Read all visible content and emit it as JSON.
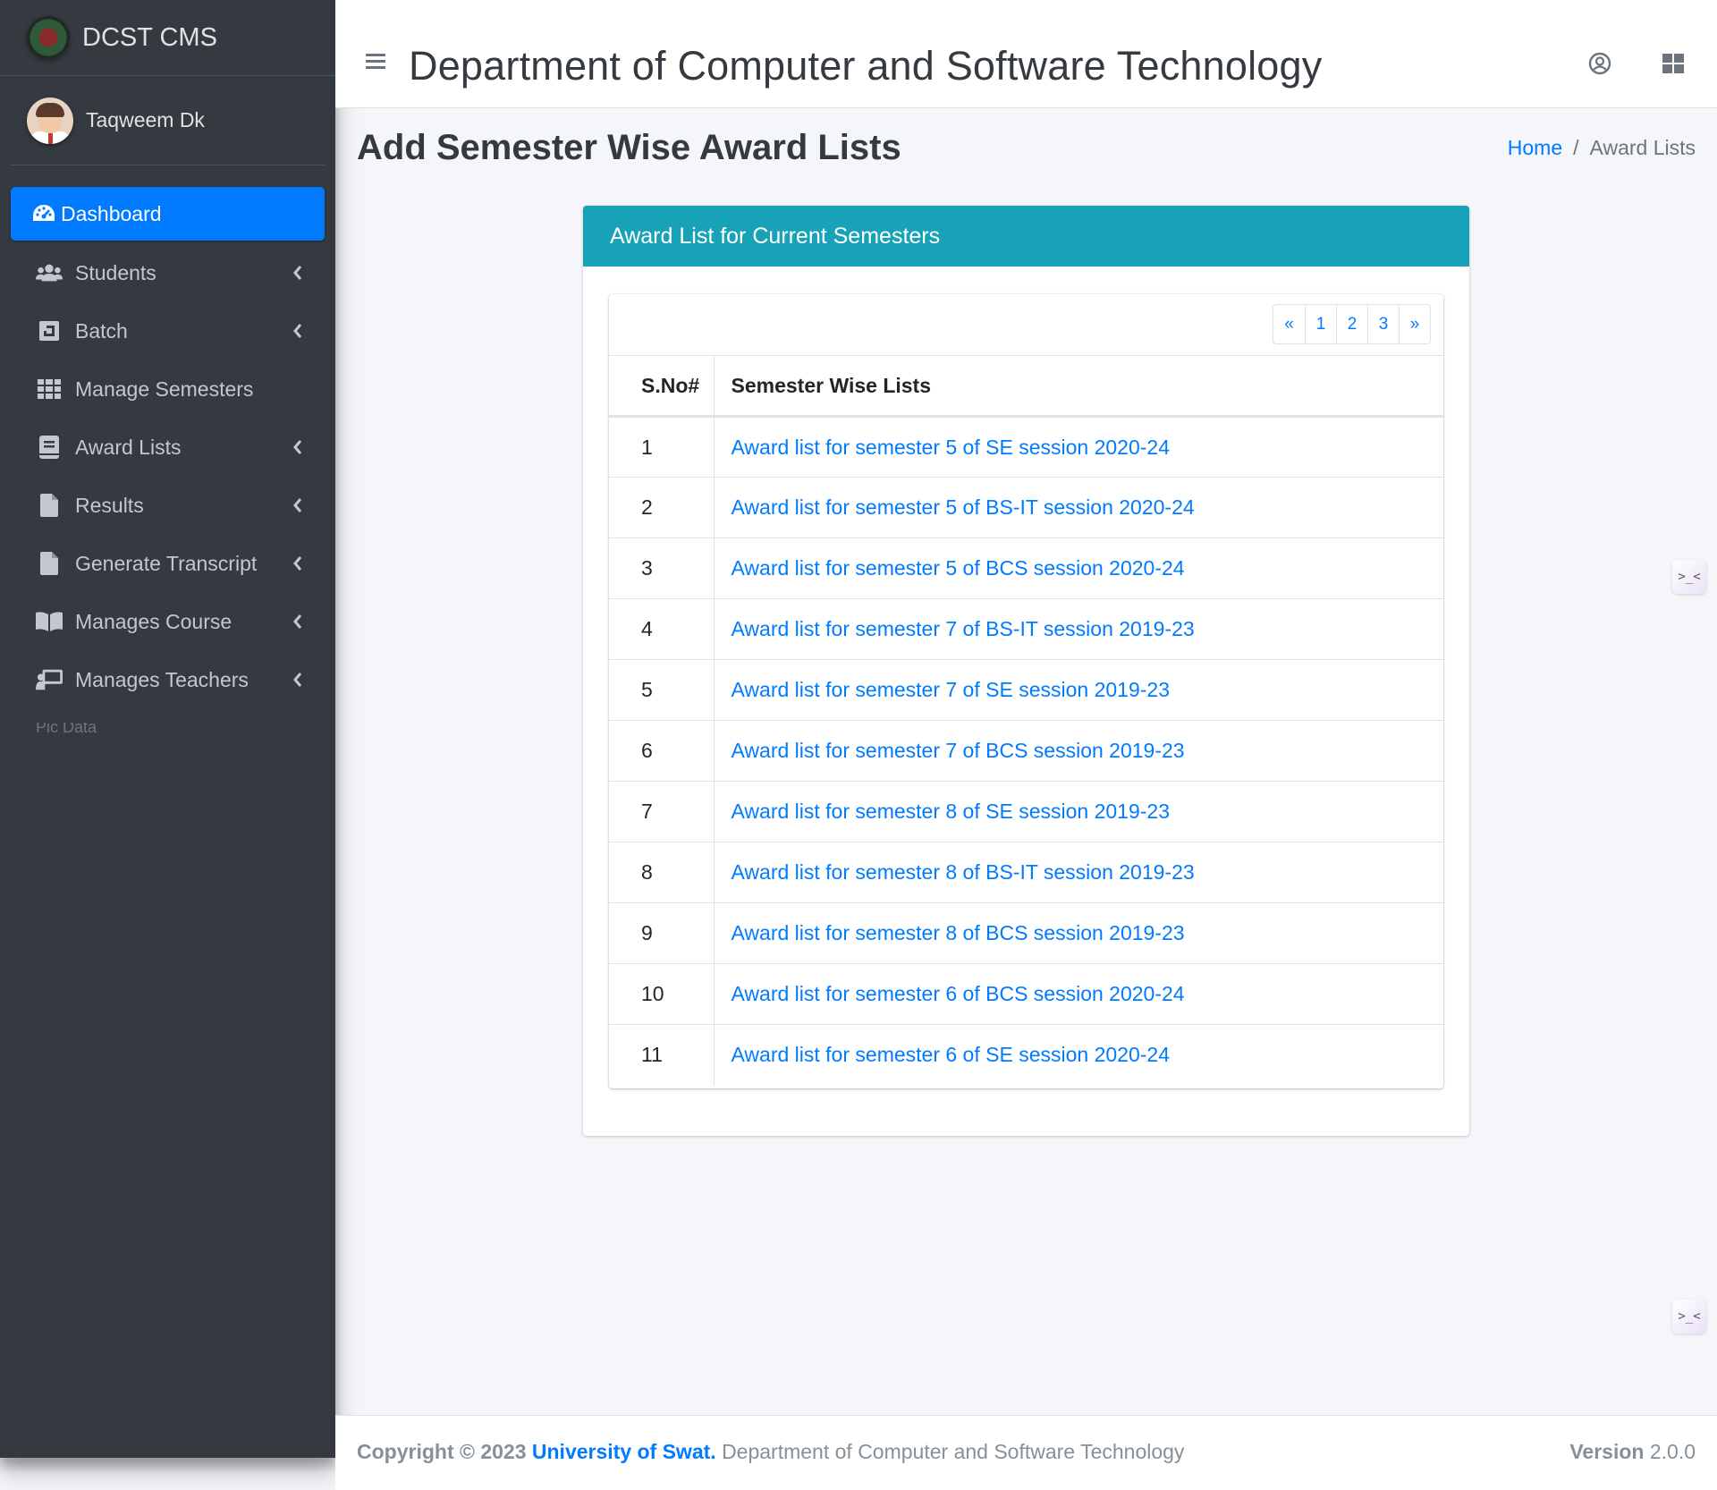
{
  "sidebar": {
    "brand": "DCST CMS",
    "user_name": "Taqweem Dk",
    "items": [
      {
        "label": "Dashboard",
        "icon": "tachometer-icon",
        "active": true,
        "has_children": false
      },
      {
        "label": "Students",
        "icon": "users-icon",
        "has_children": true
      },
      {
        "label": "Batch",
        "icon": "box-icon",
        "has_children": true
      },
      {
        "label": "Manage Semesters",
        "icon": "grid-icon",
        "has_children": false
      },
      {
        "label": "Award Lists",
        "icon": "book-icon",
        "has_children": true
      },
      {
        "label": "Results",
        "icon": "file-icon",
        "has_children": true
      },
      {
        "label": "Generate Transcript",
        "icon": "file-icon",
        "has_children": true
      },
      {
        "label": "Manages Course",
        "icon": "open-book-icon",
        "has_children": true
      },
      {
        "label": "Manages Teachers",
        "icon": "chalkboard-teacher-icon",
        "has_children": true
      }
    ],
    "faded_text": "Pic Data"
  },
  "header": {
    "title": "Department of Computer and Software Technology"
  },
  "content": {
    "page_title": "Add Semester Wise Award Lists",
    "breadcrumb": {
      "home": "Home",
      "current": "Award Lists"
    }
  },
  "card": {
    "title": "Award List for Current Semesters",
    "pagination": [
      "«",
      "1",
      "2",
      "3",
      "»"
    ],
    "columns": [
      "S.No#",
      "Semester Wise Lists"
    ],
    "rows": [
      {
        "sno": "1",
        "label": "Award list for semester 5 of SE session 2020-24"
      },
      {
        "sno": "2",
        "label": "Award list for semester 5 of BS-IT session 2020-24"
      },
      {
        "sno": "3",
        "label": "Award list for semester 5 of BCS session 2020-24"
      },
      {
        "sno": "4",
        "label": "Award list for semester 7 of BS-IT session 2019-23"
      },
      {
        "sno": "5",
        "label": "Award list for semester 7 of SE session 2019-23"
      },
      {
        "sno": "6",
        "label": "Award list for semester 7 of BCS session 2019-23"
      },
      {
        "sno": "7",
        "label": "Award list for semester 8 of SE session 2019-23"
      },
      {
        "sno": "8",
        "label": "Award list for semester 8 of BS-IT session 2019-23"
      },
      {
        "sno": "9",
        "label": "Award list for semester 8 of BCS session 2019-23"
      },
      {
        "sno": "10",
        "label": "Award list for semester 6 of BCS session 2020-24"
      },
      {
        "sno": "11",
        "label": "Award list for semester 6 of SE session 2020-24"
      }
    ]
  },
  "footer": {
    "copyright": "Copyright © 2023",
    "org_link": "University of Swat.",
    "org_text": "Department of Computer and Software Technology",
    "version_label": "Version",
    "version": "2.0.0"
  },
  "widget_glyph": ">_<",
  "colors": {
    "primary": "#007bff",
    "info": "#17a2b8",
    "sidebar_bg": "#343a40"
  }
}
